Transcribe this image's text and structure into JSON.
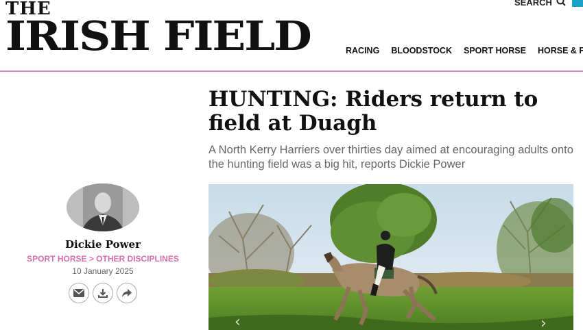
{
  "site": {
    "logo_top": "THE",
    "logo_main": "IRISH FIELD",
    "search_label": "SEARCH",
    "accent_color": "#cf8fb6",
    "search_button_color": "#1aa3c9"
  },
  "nav": {
    "items": [
      {
        "label": "RACING"
      },
      {
        "label": "BLOODSTOCK"
      },
      {
        "label": "SPORT HORSE"
      },
      {
        "label": "HORSE & FARM"
      }
    ]
  },
  "article": {
    "headline": "HUNTING: Riders return to field at Duagh",
    "standfirst": "A North Kerry Harriers over thirties day aimed at encouraging adults onto the hunting field was a big hit, reports Dickie Power",
    "author": "Dickie Power",
    "section_path": "SPORT HORSE > OTHER DISCIPLINES",
    "date": "10 January 2025",
    "share_icons": [
      "email-icon",
      "download-icon",
      "share-icon"
    ],
    "photo_icons": [
      "prev-arrow-icon",
      "next-arrow-icon"
    ]
  }
}
